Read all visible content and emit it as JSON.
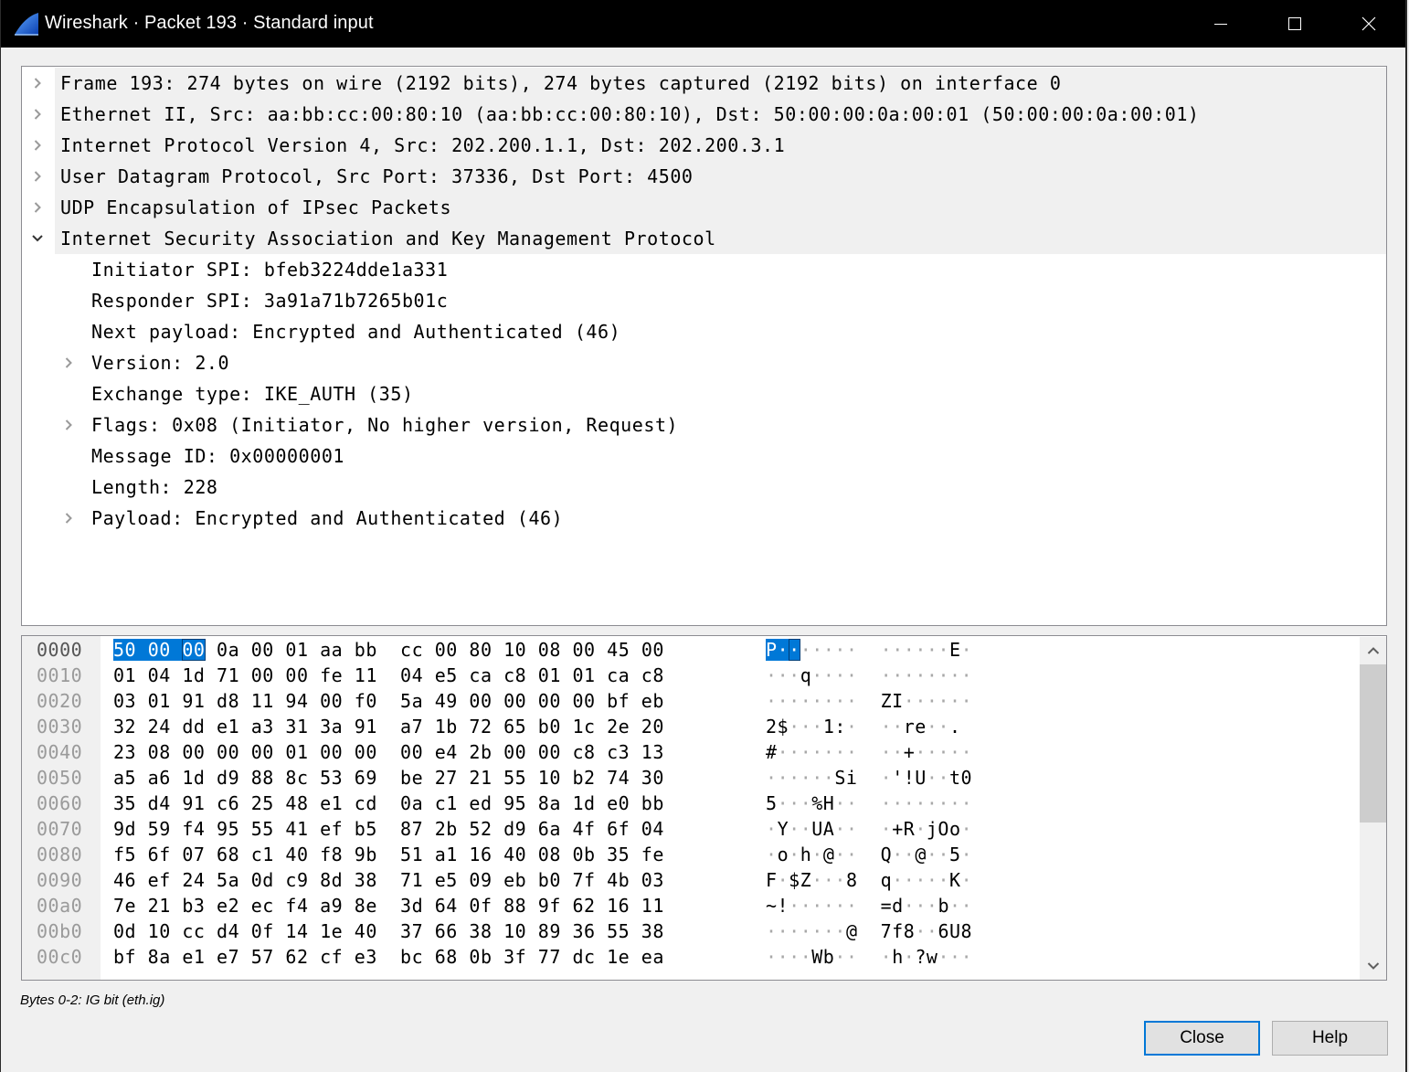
{
  "window": {
    "title": "Wireshark · Packet 193 · Standard input",
    "app_icon": "wireshark-fin-icon",
    "controls": {
      "minimize": "minimize-icon",
      "maximize": "maximize-icon",
      "close": "close-icon"
    }
  },
  "colors": {
    "selection": "#0078d7",
    "titlebar": "#000000",
    "row_highlight": "#f0f0f0",
    "offset_text": "#9a9a9a"
  },
  "tree": {
    "rows": [
      {
        "text": "Frame 193: 274 bytes on wire (2192 bits), 274 bytes captured (2192 bits) on interface 0",
        "expander": "collapsed",
        "level": 0
      },
      {
        "text": "Ethernet II, Src: aa:bb:cc:00:80:10 (aa:bb:cc:00:80:10), Dst: 50:00:00:0a:00:01 (50:00:00:0a:00:01)",
        "expander": "collapsed",
        "level": 0
      },
      {
        "text": "Internet Protocol Version 4, Src: 202.200.1.1, Dst: 202.200.3.1",
        "expander": "collapsed",
        "level": 0
      },
      {
        "text": "User Datagram Protocol, Src Port: 37336, Dst Port: 4500",
        "expander": "collapsed",
        "level": 0
      },
      {
        "text": "UDP Encapsulation of IPsec Packets",
        "expander": "collapsed",
        "level": 0
      },
      {
        "text": "Internet Security Association and Key Management Protocol",
        "expander": "expanded",
        "level": 0
      },
      {
        "text": "Initiator SPI: bfeb3224dde1a331",
        "expander": "none",
        "level": 1
      },
      {
        "text": "Responder SPI: 3a91a71b7265b01c",
        "expander": "none",
        "level": 1
      },
      {
        "text": "Next payload: Encrypted and Authenticated (46)",
        "expander": "none",
        "level": 1
      },
      {
        "text": "Version: 2.0",
        "expander": "collapsed",
        "level": 1
      },
      {
        "text": "Exchange type: IKE_AUTH (35)",
        "expander": "none",
        "level": 1
      },
      {
        "text": "Flags: 0x08 (Initiator, No higher version, Request)",
        "expander": "collapsed",
        "level": 1
      },
      {
        "text": "Message ID: 0x00000001",
        "expander": "none",
        "level": 1
      },
      {
        "text": "Length: 228",
        "expander": "none",
        "level": 1
      },
      {
        "text": "Payload: Encrypted and Authenticated (46)",
        "expander": "collapsed",
        "level": 1
      }
    ]
  },
  "hex": {
    "selected_bytes": [
      0,
      2
    ],
    "rows": [
      {
        "offset": "0000",
        "bytes": "50 00 00 0a 00 01 aa bb  cc 00 80 10 08 00 45 00",
        "ascii": "P·······  ······E·"
      },
      {
        "offset": "0010",
        "bytes": "01 04 1d 71 00 00 fe 11  04 e5 ca c8 01 01 ca c8",
        "ascii": "···q····  ········"
      },
      {
        "offset": "0020",
        "bytes": "03 01 91 d8 11 94 00 f0  5a 49 00 00 00 00 bf eb",
        "ascii": "········  ZI······"
      },
      {
        "offset": "0030",
        "bytes": "32 24 dd e1 a3 31 3a 91  a7 1b 72 65 b0 1c 2e 20",
        "ascii": "2$···1:·  ··re··. "
      },
      {
        "offset": "0040",
        "bytes": "23 08 00 00 00 01 00 00  00 e4 2b 00 00 c8 c3 13",
        "ascii": "#·······  ··+·····"
      },
      {
        "offset": "0050",
        "bytes": "a5 a6 1d d9 88 8c 53 69  be 27 21 55 10 b2 74 30",
        "ascii": "······Si  ·'!U··t0"
      },
      {
        "offset": "0060",
        "bytes": "35 d4 91 c6 25 48 e1 cd  0a c1 ed 95 8a 1d e0 bb",
        "ascii": "5···%H··  ········"
      },
      {
        "offset": "0070",
        "bytes": "9d 59 f4 95 55 41 ef b5  87 2b 52 d9 6a 4f 6f 04",
        "ascii": "·Y··UA··  ·+R·jOo·"
      },
      {
        "offset": "0080",
        "bytes": "f5 6f 07 68 c1 40 f8 9b  51 a1 16 40 08 0b 35 fe",
        "ascii": "·o·h·@··  Q··@··5·"
      },
      {
        "offset": "0090",
        "bytes": "46 ef 24 5a 0d c9 8d 38  71 e5 09 eb b0 7f 4b 03",
        "ascii": "F·$Z···8  q·····K·"
      },
      {
        "offset": "00a0",
        "bytes": "7e 21 b3 e2 ec f4 a9 8e  3d 64 0f 88 9f 62 16 11",
        "ascii": "~!······  =d···b··"
      },
      {
        "offset": "00b0",
        "bytes": "0d 10 cc d4 0f 14 1e 40  37 66 38 10 89 36 55 38",
        "ascii": "·······@  7f8··6U8"
      },
      {
        "offset": "00c0",
        "bytes": "bf 8a e1 e7 57 62 cf e3  bc 68 0b 3f 77 dc 1e ea",
        "ascii": "····Wb··  ·h·?w···"
      }
    ],
    "scroll": {
      "position": 0.0,
      "visible_fraction": 0.55
    }
  },
  "status": {
    "text": "Bytes 0-2: IG bit (eth.ig)"
  },
  "buttons": {
    "close": "Close",
    "help": "Help"
  }
}
